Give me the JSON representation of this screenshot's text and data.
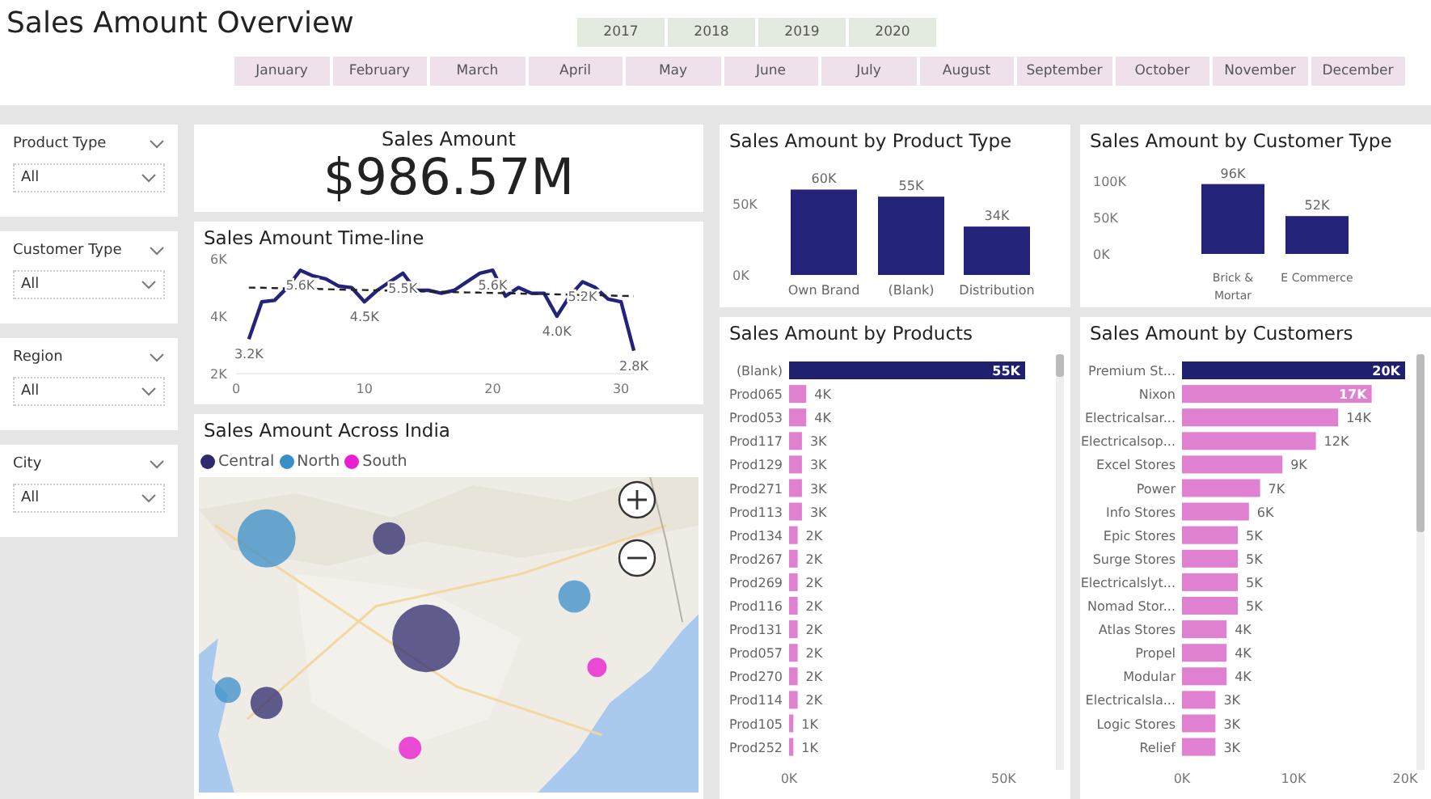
{
  "title": "Sales Amount Overview",
  "years": [
    {
      "label": "2017",
      "selected": false
    },
    {
      "label": "2018",
      "selected": false
    },
    {
      "label": "2019",
      "selected": false
    },
    {
      "label": "2020",
      "selected": false
    }
  ],
  "months": [
    {
      "label": "January",
      "selected": false
    },
    {
      "label": "February",
      "selected": false
    },
    {
      "label": "March",
      "selected": false
    },
    {
      "label": "April",
      "selected": false
    },
    {
      "label": "May",
      "selected": false
    },
    {
      "label": "June",
      "selected": false
    },
    {
      "label": "July",
      "selected": false
    },
    {
      "label": "August",
      "selected": false
    },
    {
      "label": "September",
      "selected": false
    },
    {
      "label": "October",
      "selected": false
    },
    {
      "label": "November",
      "selected": false
    },
    {
      "label": "December",
      "selected": false
    }
  ],
  "slicers": [
    {
      "label": "Product Type",
      "value": "All"
    },
    {
      "label": "Customer Type",
      "value": "All"
    },
    {
      "label": "Region",
      "value": "All"
    },
    {
      "label": "City",
      "value": "All"
    }
  ],
  "kpi": {
    "title": "Sales Amount",
    "value": "$986.57M"
  },
  "timeline": {
    "title": "Sales Amount Time-line",
    "chart_data": {
      "type": "line",
      "x": [
        1,
        2,
        3,
        4,
        5,
        6,
        7,
        8,
        9,
        10,
        11,
        12,
        13,
        14,
        15,
        16,
        17,
        18,
        19,
        20,
        21,
        22,
        23,
        24,
        25,
        26,
        27,
        28,
        29,
        30,
        31
      ],
      "series": [
        {
          "color": "#23237a",
          "values": [
            3200,
            4500,
            4550,
            5000,
            5600,
            5400,
            5300,
            5050,
            5000,
            4500,
            4900,
            5200,
            5500,
            4900,
            4900,
            4800,
            4900,
            5200,
            5500,
            5600,
            4700,
            5000,
            4800,
            4800,
            4000,
            4700,
            5200,
            5000,
            4600,
            4500,
            2800
          ]
        },
        {
          "color": "#222222",
          "line_style": "dashed",
          "values": [
            5000,
            4990,
            4980,
            4970,
            4960,
            4950,
            4940,
            4930,
            4920,
            4910,
            4900,
            4890,
            4880,
            4870,
            4860,
            4850,
            4840,
            4830,
            4820,
            4810,
            4800,
            4790,
            4780,
            4770,
            4760,
            4750,
            4740,
            4730,
            4720,
            4710,
            4700
          ]
        }
      ],
      "xlim": [
        0,
        31
      ],
      "ylim": [
        2000,
        6000
      ],
      "xticks": [
        0,
        10,
        20,
        30
      ],
      "yticks": [
        {
          "value": 2000,
          "label": "2K"
        },
        {
          "value": 4000,
          "label": "4K"
        },
        {
          "value": 6000,
          "label": "6K"
        }
      ],
      "value_labels": [
        "3.2K",
        null,
        null,
        null,
        "5.6K",
        null,
        null,
        null,
        null,
        "4.5K",
        null,
        null,
        "5.5K",
        null,
        null,
        null,
        null,
        null,
        null,
        "5.6K",
        null,
        null,
        null,
        null,
        "4.0K",
        null,
        "5.2K",
        null,
        null,
        null,
        "2.8K"
      ]
    }
  },
  "map": {
    "title": "Sales Amount Across India",
    "legend": [
      {
        "label": "Central",
        "color": "#2e2a6e"
      },
      {
        "label": "North",
        "color": "#3a8fc8"
      },
      {
        "label": "South",
        "color": "#e820d0"
      }
    ]
  },
  "product_type": {
    "title": "Sales Amount by Product Type",
    "chart_data": {
      "type": "bar",
      "categories": [
        "Own Brand",
        "(Blank)",
        "Distribution"
      ],
      "series": [
        {
          "color": "#23237a",
          "values": [
            60000,
            55000,
            34000
          ]
        }
      ],
      "ylim": [
        0,
        60000
      ],
      "yticks": [
        {
          "value": 0,
          "label": "0K"
        },
        {
          "value": 50000,
          "label": "50K"
        }
      ],
      "value_labels": [
        "60K",
        "55K",
        "34K"
      ]
    }
  },
  "customer_type": {
    "title": "Sales Amount by Customer Type",
    "chart_data": {
      "type": "bar",
      "categories": [
        "Brick & Mortar",
        "E Commerce"
      ],
      "series": [
        {
          "color": "#23237a",
          "values": [
            96000,
            52000
          ]
        }
      ],
      "ylim": [
        0,
        100000
      ],
      "yticks": [
        {
          "value": 0,
          "label": "0K"
        },
        {
          "value": 50000,
          "label": "50K"
        },
        {
          "value": 100000,
          "label": "100K"
        }
      ],
      "value_labels": [
        "96K",
        "52K"
      ]
    }
  },
  "products": {
    "title": "Sales Amount by Products",
    "chart_data": {
      "type": "bar",
      "orientation": "horizontal",
      "categories": [
        "(Blank)",
        "Prod065",
        "Prod053",
        "Prod117",
        "Prod129",
        "Prod271",
        "Prod113",
        "Prod134",
        "Prod267",
        "Prod269",
        "Prod116",
        "Prod131",
        "Prod057",
        "Prod270",
        "Prod114",
        "Prod105",
        "Prod252"
      ],
      "series": [
        {
          "values": [
            55000,
            4000,
            4000,
            3000,
            3000,
            3000,
            3000,
            2000,
            2000,
            2000,
            2000,
            2000,
            2000,
            2000,
            2000,
            1000,
            1000
          ]
        }
      ],
      "xlim": [
        0,
        55000
      ],
      "xticks": [
        {
          "value": 0,
          "label": "0K"
        },
        {
          "value": 50000,
          "label": "50K"
        }
      ],
      "value_labels": [
        "55K",
        "4K",
        "4K",
        "3K",
        "3K",
        "3K",
        "3K",
        "2K",
        "2K",
        "2K",
        "2K",
        "2K",
        "2K",
        "2K",
        "2K",
        "1K",
        "1K"
      ]
    }
  },
  "customers": {
    "title": "Sales Amount by Customers",
    "chart_data": {
      "type": "bar",
      "orientation": "horizontal",
      "categories": [
        "Premium St...",
        "Nixon",
        "Electricalsar...",
        "Electricalsop...",
        "Excel Stores",
        "Power",
        "Info Stores",
        "Epic Stores",
        "Surge Stores",
        "Electricalslyt...",
        "Nomad Stor...",
        "Atlas Stores",
        "Propel",
        "Modular",
        "Electricalsla...",
        "Logic Stores",
        "Relief"
      ],
      "series": [
        {
          "values": [
            20000,
            17000,
            14000,
            12000,
            9000,
            7000,
            6000,
            5000,
            5000,
            5000,
            5000,
            4000,
            4000,
            4000,
            3000,
            3000,
            3000
          ]
        }
      ],
      "xlim": [
        0,
        20000
      ],
      "xticks": [
        {
          "value": 0,
          "label": "0K"
        },
        {
          "value": 10000,
          "label": "10K"
        },
        {
          "value": 20000,
          "label": "20K"
        }
      ],
      "value_labels": [
        "20K",
        "17K",
        "14K",
        "12K",
        "9K",
        "7K",
        "6K",
        "5K",
        "5K",
        "5K",
        "5K",
        "4K",
        "4K",
        "4K",
        "3K",
        "3K",
        "3K"
      ]
    }
  }
}
